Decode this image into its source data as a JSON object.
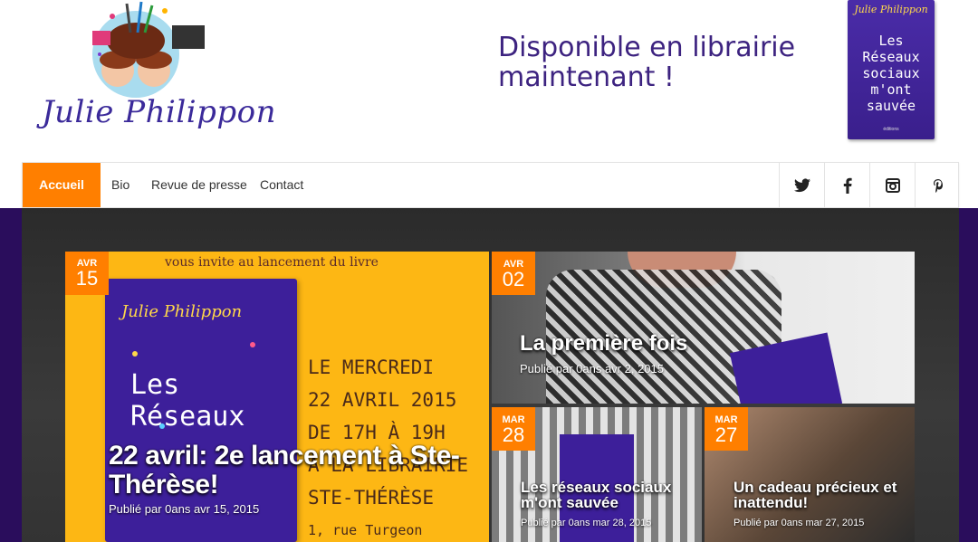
{
  "header": {
    "logo_text": "Julie Philippon",
    "tagline": "Disponible en librairie maintenant !",
    "book_cover": {
      "author": "Julie Philippon",
      "title": "Les Réseaux sociaux m'ont sauvée",
      "publisher": "éditions"
    }
  },
  "nav": {
    "items": [
      {
        "label": "Accueil",
        "active": true
      },
      {
        "label": "Bio"
      },
      {
        "label": "Revue de presse"
      },
      {
        "label": "Contact"
      }
    ],
    "social": [
      {
        "name": "twitter-icon",
        "glyph": "🐦"
      },
      {
        "name": "facebook-icon",
        "glyph": "f"
      },
      {
        "name": "instagram-icon",
        "glyph": "◙"
      },
      {
        "name": "pinterest-icon",
        "glyph": "𝒑"
      }
    ]
  },
  "posts": [
    {
      "month": "AVR",
      "day": "15",
      "title": "22 avril: 2e lancement à Ste-Thérèse!",
      "meta": "Publié par 0ans avr 15, 2015",
      "image_text": {
        "invite": "vous invite au lancement du livre",
        "author": "Julie Philippon",
        "book_title": "Les Réseaux",
        "lines": [
          "LE MERCREDI",
          "22 AVRIL 2015",
          "DE 17H À 19H",
          "À LA LIBRAIRIE",
          "STE-THÉRÈSE",
          "1, rue Turgeon"
        ]
      }
    },
    {
      "month": "AVR",
      "day": "02",
      "title": "La première fois",
      "meta": "Publié par 0ans avr 2, 2015"
    },
    {
      "month": "MAR",
      "day": "28",
      "title": "Les réseaux sociaux m'ont sauvée",
      "meta": "Publié par 0ans mar 28, 2015"
    },
    {
      "month": "MAR",
      "day": "27",
      "title": "Un cadeau précieux et inattendu!",
      "meta": "Publié par 0ans mar 27, 2015"
    }
  ],
  "colors": {
    "accent": "#ff7f00",
    "brand_purple": "#3d2380",
    "band": "#2a0d5c"
  }
}
